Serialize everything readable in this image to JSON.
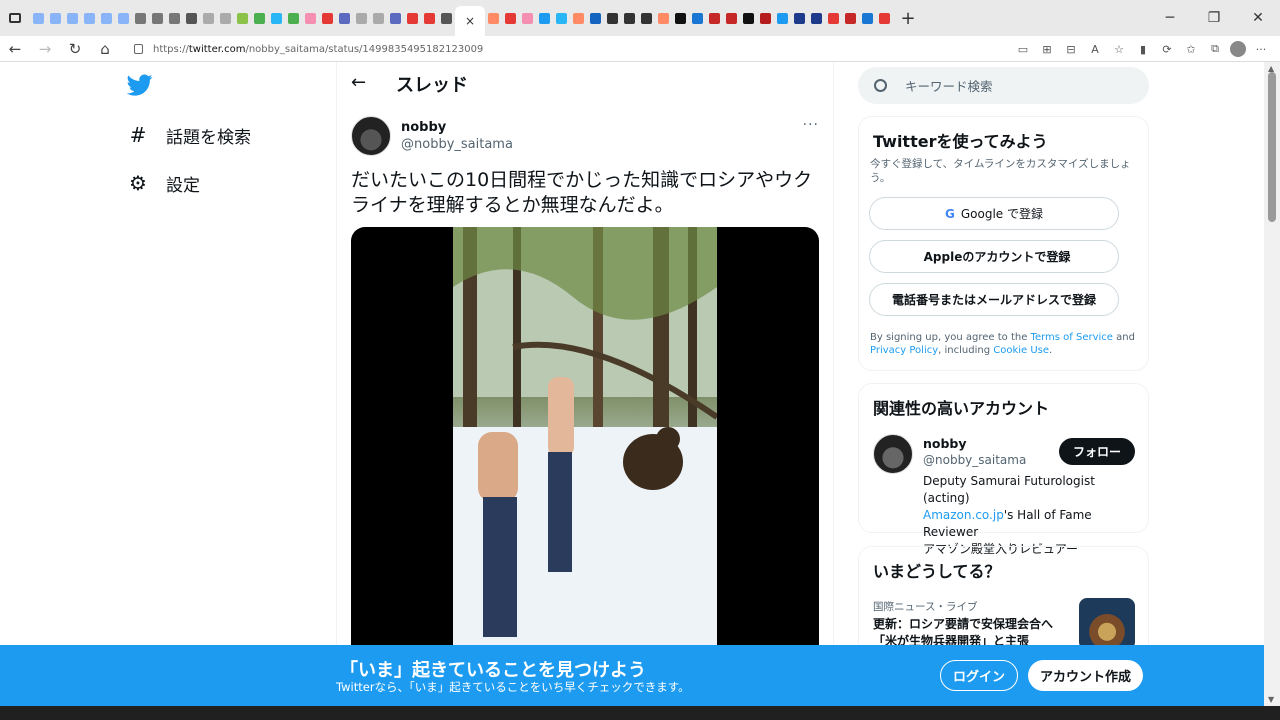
{
  "browser": {
    "tab_favicon_colors": [
      "#8ab4f8",
      "#8ab4f8",
      "#8ab4f8",
      "#8ab4f8",
      "#8ab4f8",
      "#8ab4f8",
      "#777",
      "#777",
      "#777",
      "#555",
      "#aaa",
      "#aaa",
      "#8bc34a",
      "#4caf50",
      "#29b6f6",
      "#4caf50",
      "#f48fb1",
      "#e53935",
      "#5c6bc0",
      "#aaa",
      "#aaa",
      "#5c6bc0",
      "#e53935",
      "#e53935",
      "#555",
      "#ff8a65",
      "#e53935",
      "#f48fb1",
      "#1d9bf0",
      "#29b6f6",
      "#ff8a65",
      "#1565c0",
      "#333",
      "#333",
      "#333",
      "#ff8a65",
      "#111",
      "#1976d2",
      "#c62828",
      "#c62828",
      "#111",
      "#b71c1c",
      "#1d9bf0",
      "#1e3a8a",
      "#1e3a8a",
      "#e53935",
      "#c62828",
      "#1976d2",
      "#e53935"
    ],
    "active_tab_close": "×",
    "new_tab": "+",
    "window_controls": [
      "─",
      "❐",
      "✕"
    ],
    "nav": {
      "back": "←",
      "forward": "→",
      "reload": "↻",
      "home": "⌂"
    },
    "url_prefix": "https://",
    "url_host": "twitter.com",
    "url_path": "/nobby_saitama/status/1499835495182123009",
    "tool_icons": [
      "▭",
      "⊞",
      "⊟",
      "A",
      "☆",
      "▮",
      "⟳",
      "✩",
      "⧉"
    ],
    "menu": "···"
  },
  "leftnav": {
    "items": [
      {
        "icon": "#",
        "label": "話題を検索"
      },
      {
        "icon": "⚙",
        "label": "設定"
      }
    ]
  },
  "thread": {
    "back": "←",
    "title": "スレッド",
    "author_name": "nobby",
    "author_handle": "@nobby_saitama",
    "more": "···",
    "text": "だいたいこの10日間程でかじった知識でロシアやウクライナを理解するとか無理なんだよ。"
  },
  "right": {
    "search_placeholder": "キーワード検索",
    "signup": {
      "title": "Twitterを使ってみよう",
      "subtitle": "今すぐ登録して、タイムラインをカスタマイズしましょう。",
      "google_icon": "G",
      "google_label": "Google で登録",
      "apple_icon": "",
      "apple_label": "Appleのアカウントで登録",
      "phone_label": "電話番号またはメールアドレスで登録",
      "legal_1": "By signing up, you agree to the ",
      "terms": "Terms of Service",
      "legal_2": " and ",
      "privacy": "Privacy Policy",
      "legal_3": ", including ",
      "cookie": "Cookie Use",
      "legal_4": "."
    },
    "related": {
      "title": "関連性の高いアカウント",
      "name": "nobby",
      "handle": "@nobby_saitama",
      "follow": "フォロー",
      "bio_1": "Deputy Samurai Futurologist (acting)",
      "bio_link": "Amazon.co.jp",
      "bio_2": "'s Hall of Fame Reviewer",
      "bio_3": "アマゾン殿堂入りレビュアー"
    },
    "trends": {
      "title": "いまどうしてる？",
      "category": "国際ニュース・ライブ",
      "headline": "更新：ロシア要請で安保理会合へ 「米が生物兵器開発」と主張"
    }
  },
  "banner": {
    "title": "「いま」起きていることを見つけよう",
    "subtitle": "Twitterなら、「いま」起きていることをいち早くチェックできます。",
    "login": "ログイン",
    "signup": "アカウント作成"
  }
}
